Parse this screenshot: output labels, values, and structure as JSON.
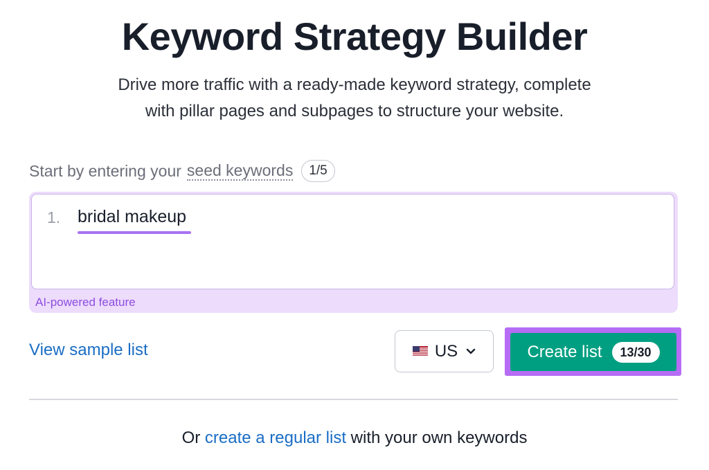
{
  "header": {
    "title": "Keyword Strategy Builder",
    "subtitle_line1": "Drive more traffic with a ready-made keyword strategy, complete",
    "subtitle_line2": "with pillar pages and subpages to structure your website."
  },
  "seed": {
    "prefix": "Start by entering your",
    "link": "seed keywords",
    "counter": "1/5"
  },
  "keywords": {
    "items": [
      {
        "number": "1.",
        "text": "bridal makeup"
      }
    ],
    "ai_label": "AI-powered feature"
  },
  "actions": {
    "sample_link": "View sample list",
    "country": "US",
    "country_flag": "us-flag-icon",
    "create_label": "Create list",
    "create_count": "13/30"
  },
  "footer": {
    "prefix": "Or",
    "link": "create a regular list",
    "suffix": "with your own keywords"
  },
  "colors": {
    "primary_button": "#009f81",
    "highlight": "#b66cf5",
    "link": "#1a6dc5",
    "ai_background": "#eddcfc"
  }
}
